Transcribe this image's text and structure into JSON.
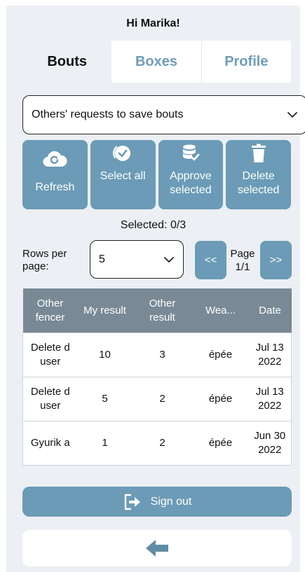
{
  "header": {
    "greeting": "Hi Marika!"
  },
  "tabs": [
    {
      "label": "Bouts",
      "active": true
    },
    {
      "label": "Boxes",
      "active": false
    },
    {
      "label": "Profile",
      "active": false
    }
  ],
  "filter": {
    "selected": "Others' requests to save bouts",
    "icon": "chevron-down-icon"
  },
  "actions": [
    {
      "label": "Refresh",
      "icon": "cloud-refresh-icon"
    },
    {
      "label": "Select all",
      "icon": "check-badge-icon"
    },
    {
      "label": "Approve selected",
      "icon": "database-check-icon"
    },
    {
      "label": "Delete selected",
      "icon": "trash-icon"
    }
  ],
  "selection": {
    "text": "Selected: 0/3"
  },
  "pagination": {
    "rows_label": "Rows per page:",
    "rows_value": "5",
    "prev_label": "<<",
    "next_label": ">>",
    "page_label": "Page",
    "page_value": "1/1"
  },
  "table": {
    "headers": [
      "Other fencer",
      "My result",
      "Other result",
      "Wea...",
      "Date"
    ],
    "rows": [
      [
        "Delete d user",
        "10",
        "3",
        "épée",
        "Jul 13 2022"
      ],
      [
        "Delete d user",
        "5",
        "2",
        "épée",
        "Jul 13 2022"
      ],
      [
        "Gyurik a",
        "1",
        "2",
        "épée",
        "Jun 30 2022"
      ]
    ]
  },
  "footer": {
    "signout_label": "Sign out",
    "signout_icon": "sign-out-icon",
    "back_icon": "arrow-left-icon"
  },
  "colors": {
    "accent": "#6b9bb6",
    "table_header": "#798995",
    "background": "#eceff3",
    "tab_inactive_text": "#6f9db9"
  }
}
